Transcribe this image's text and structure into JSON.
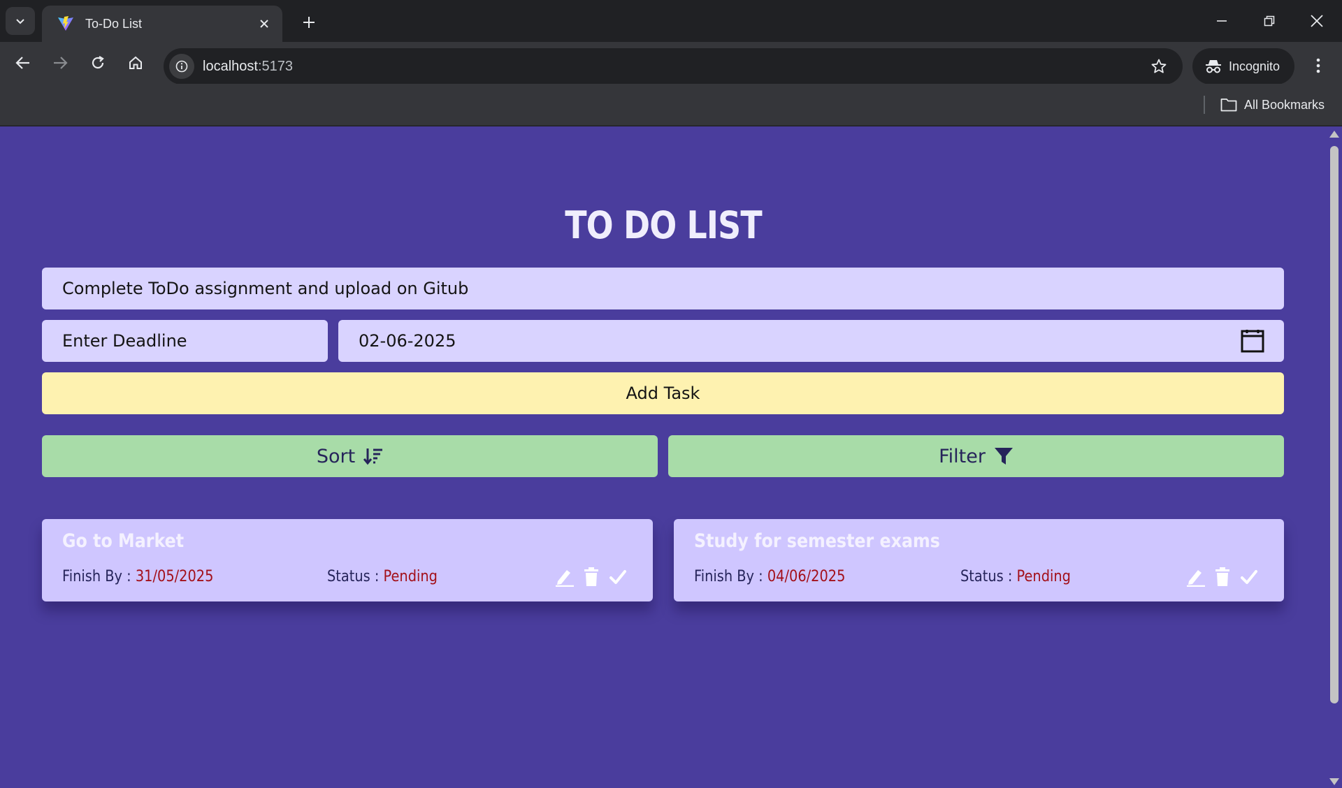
{
  "browser": {
    "tab_title": "To-Do List",
    "url_host": "localhost",
    "url_port": ":5173",
    "incognito_label": "Incognito",
    "bookmarks_label": "All Bookmarks"
  },
  "app": {
    "title": "TO DO LIST",
    "task_input_value": "Complete ToDo assignment and upload on Gitub",
    "deadline_label": "Enter Deadline",
    "date_value": "02-06-2025",
    "add_button": "Add Task",
    "sort_button": "Sort",
    "filter_button": "Filter"
  },
  "tasks": [
    {
      "title": "Go to Market",
      "finish_label": "Finish By : ",
      "finish_date": "31/05/2025",
      "status_label": "Status : ",
      "status": "Pending"
    },
    {
      "title": "Study for semester exams",
      "finish_label": "Finish By : ",
      "finish_date": "04/06/2025",
      "status_label": "Status : ",
      "status": "Pending"
    }
  ],
  "colors": {
    "page_bg": "#4a3d9d",
    "input_bg": "#d9d3ff",
    "add_button_bg": "#fef2b0",
    "action_button_bg": "#a8dca8",
    "card_bg": "#cfc6ff",
    "status_red": "#a3101a"
  }
}
